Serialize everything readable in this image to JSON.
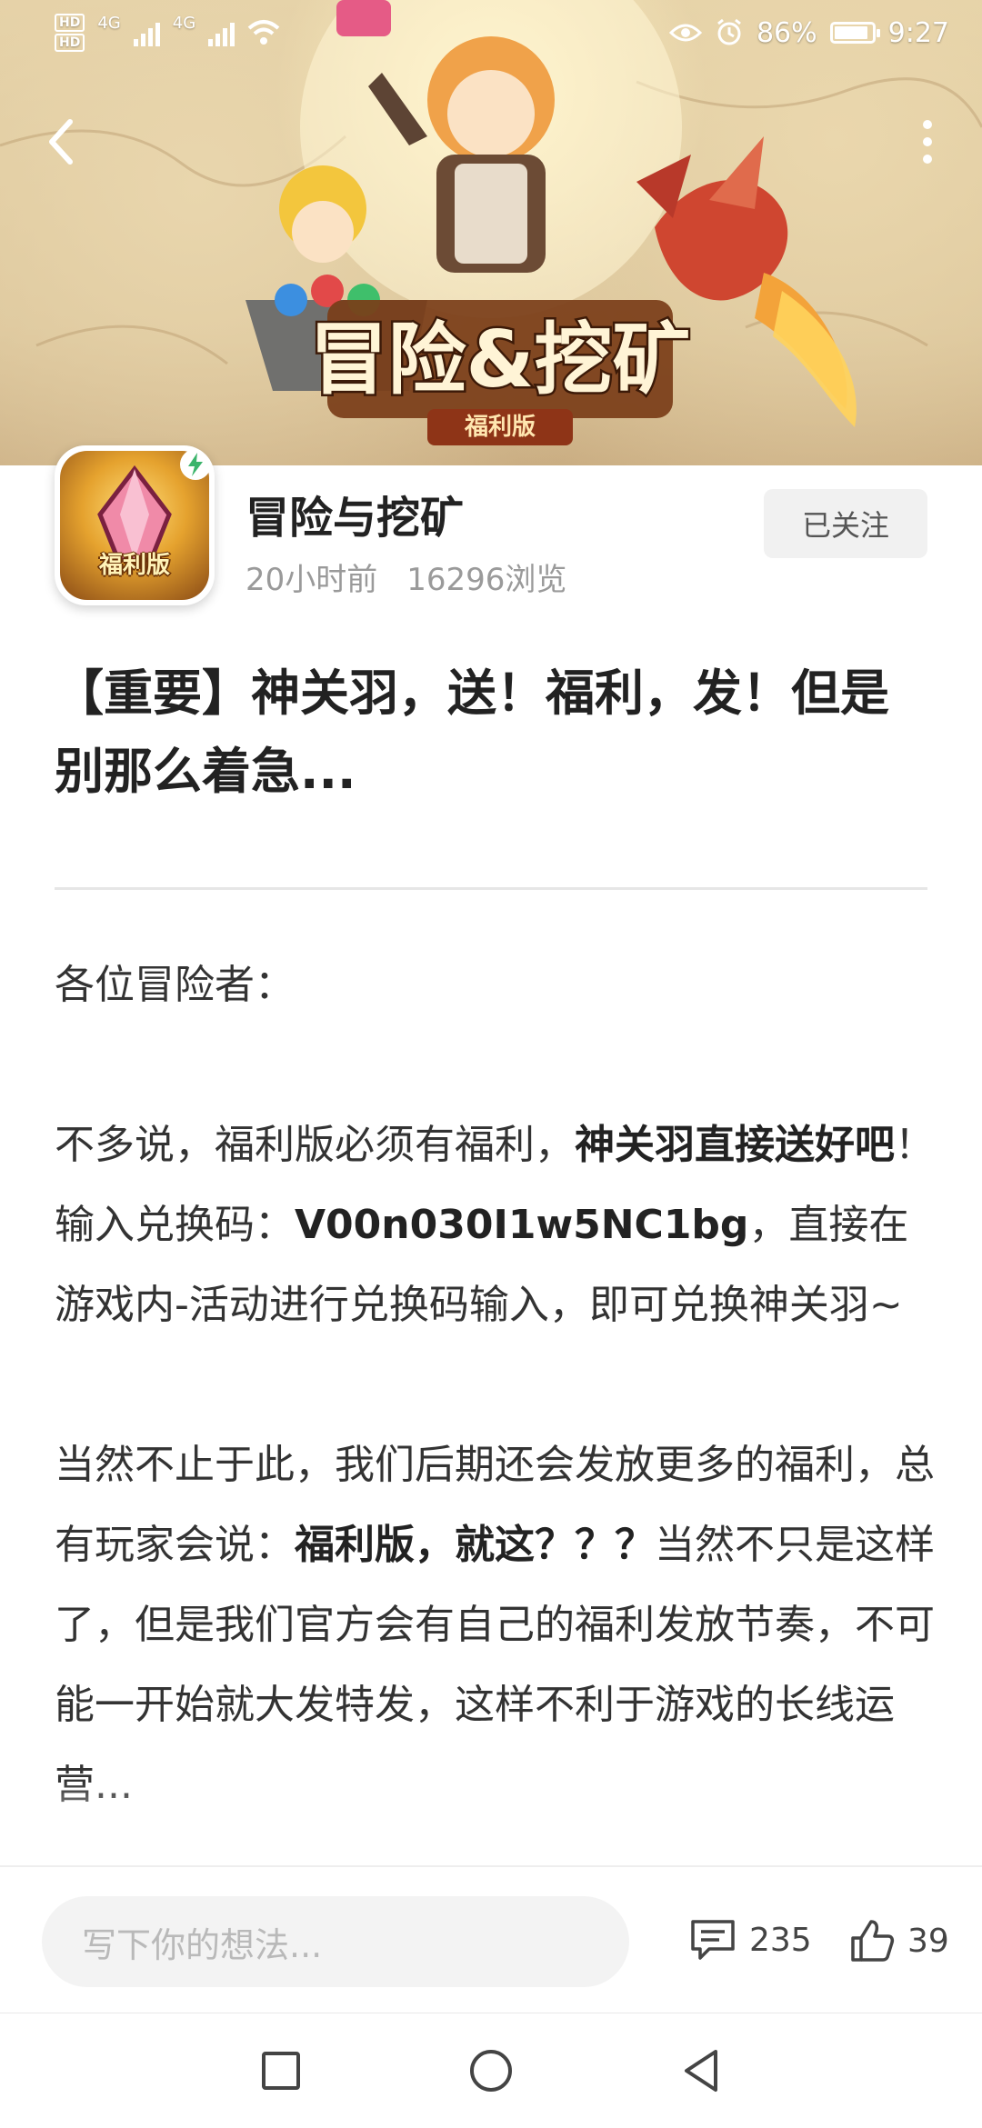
{
  "status_bar": {
    "hd_labels": [
      "HD",
      "HD"
    ],
    "network_1": "4G",
    "network_2": "4G",
    "battery": "86%",
    "time": "9:27"
  },
  "banner": {
    "game_logo": "冒险&挖矿",
    "logo_subtitle": "福利版"
  },
  "author": {
    "icon_label": "福利版",
    "name": "冒险与挖矿",
    "time_ago": "20小时前",
    "views": "16296浏览",
    "follow_label": "已关注"
  },
  "article": {
    "title": "【重要】神关羽，送！福利，发！但是别那么着急...",
    "greeting": "各位冒险者：",
    "p1_a": "不多说，福利版必须有福利，",
    "p1_b": "神关羽直接送好吧",
    "p1_c": "！输入兑换码：",
    "p1_code": "V00n030I1w5NC1bg",
    "p1_d": "，直接在游戏内-活动进行兑换码输入，即可兑换神关羽~",
    "p2_a": "当然不止于此，我们后期还会发放更多的福利，总有玩家会说：",
    "p2_b": "福利版，就这？？？",
    "p2_c": "当然不只是这样了，但是我们官方会有自己的福利发放节奏，不可能一开始就大发特发，这样不利于游戏的长线运营..."
  },
  "bottom_bar": {
    "comment_placeholder": "写下你的想法...",
    "comment_count": "235",
    "like_count": "39"
  },
  "icons": {
    "back": "chevron-left-icon",
    "more": "more-vertical-icon",
    "comment": "comment-icon",
    "like": "thumbs-up-icon"
  },
  "colors": {
    "accent_text": "#222222",
    "meta_text": "#9a9a9a",
    "follow_bg": "#f1f1f1"
  }
}
